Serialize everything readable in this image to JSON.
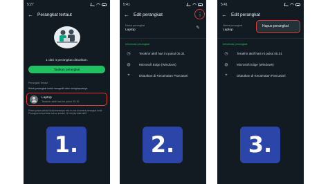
{
  "colors": {
    "background": "#121b22",
    "accent": "#21c063",
    "highlight": "#e53935",
    "step_badge": "#2c45a8",
    "text": "#e9edef",
    "muted": "#8696a0"
  },
  "panel1": {
    "time": "5:27",
    "title": "Perangkat tertaut",
    "device_count": "1 dari 4 perangkat ditautkan.",
    "link_button": "Tautkan perangkat",
    "section_label": "Perangkat Tertaut",
    "hint": "Ketuk perangkat untuk mengedit atau menghapusnya",
    "device": {
      "name": "Laptop",
      "status": "Terakhir aktif hari ini pukul 05.32"
    },
    "footnote": "Pesan-pesan pribadi Anda terenkripsi end-to-end di semua perangkat Anda. Perangkat tertaut akan keluar setelah 14 hari jika tidak aktif.",
    "step": "1."
  },
  "panel2": {
    "time": "5:41",
    "title": "Edit perangkat",
    "name_label": "Nama perangkat",
    "name_value": "Laptop",
    "info_label": "Informasi perangkat",
    "rows": [
      {
        "icon": "clock-icon",
        "glyph": "◷",
        "text": "Terakhir aktif hari ini pukul 05.31"
      },
      {
        "icon": "globe-icon",
        "glyph": "◍",
        "text": "Microsoft Edge (Windows)"
      },
      {
        "icon": "location-icon",
        "glyph": "⌖",
        "text": "Ditautkan di Kecamatan Pancasari"
      }
    ],
    "step": "2."
  },
  "panel3": {
    "time": "5:41",
    "title": "Edit perangkat",
    "name_label": "Nama perangkat",
    "name_value": "Laptop",
    "menu_item": "Hapus perangkat",
    "info_label": "Informasi perangkat",
    "rows": [
      {
        "icon": "clock-icon",
        "glyph": "◷",
        "text": "Terakhir aktif hari ini pukul 05.31"
      },
      {
        "icon": "globe-icon",
        "glyph": "◍",
        "text": "Microsoft Edge (Windows)"
      },
      {
        "icon": "location-icon",
        "glyph": "⌖",
        "text": "Ditautkan di Kecamatan Pancasari"
      }
    ],
    "step": "3."
  }
}
